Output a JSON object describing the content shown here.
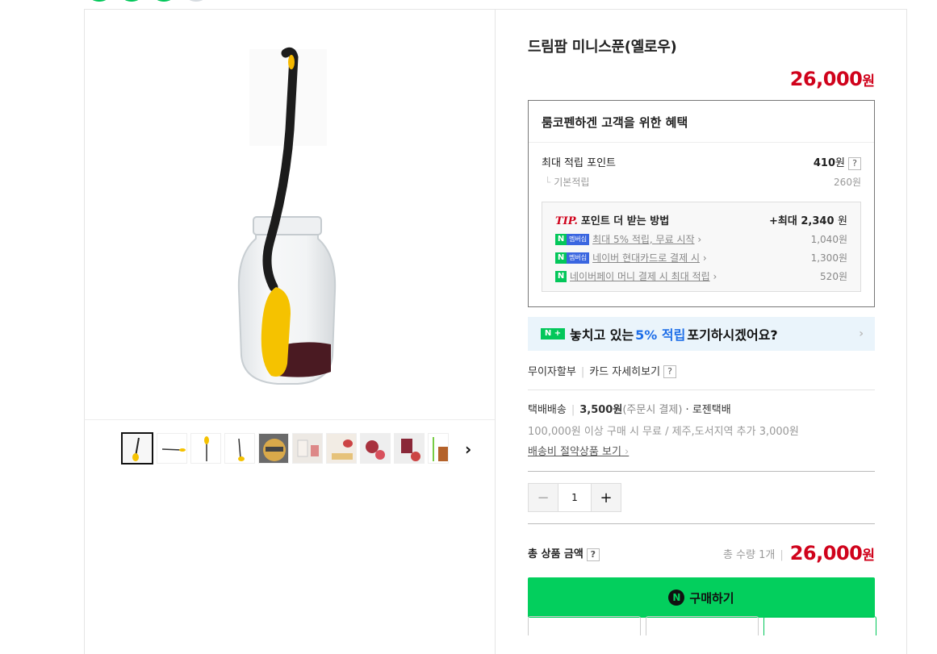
{
  "product": {
    "title": "드림팜 미니스푼(옐로우)",
    "price": "26,000",
    "currency": "원"
  },
  "gallery": {
    "next_icon": "chevron-right-icon",
    "thumbnail_count": 10,
    "selected_index": 0
  },
  "benefit": {
    "heading": "룸코펜하겐 고객을 위한 혜택",
    "max_points_label": "최대 적립 포인트",
    "max_points_value": "410",
    "max_points_unit": "원",
    "help": "?",
    "basic_label": "기본적립",
    "basic_value": "260원",
    "tip": {
      "tip_word": "TIP.",
      "heading": "포인트 더 받는 방법",
      "max_prefix": "+최대",
      "max_value": "2,340",
      "max_unit": "원",
      "items": [
        {
          "badge": "N",
          "badge2": "멤버십",
          "label": "최대 5% 적립, 무료 시작",
          "value": "1,040원"
        },
        {
          "badge": "N",
          "badge2": "멤버십",
          "label": "네이버 현대카드로 결제 시",
          "value": "1,300원"
        },
        {
          "badge": "N",
          "badge2": "",
          "label": "네이버페이 머니 결제 시 최대 적립",
          "value": "520원"
        }
      ]
    }
  },
  "banner": {
    "badge": "N +",
    "text_before": "놓치고 있는",
    "highlight": "5% 적립",
    "text_after": "포기하시겠어요?"
  },
  "card": {
    "installment": "무이자할부",
    "details": "카드 자세히보기",
    "help": "?"
  },
  "shipping": {
    "method": "택배배송",
    "fee": "3,500원",
    "fee_note": "(주문시 결제)",
    "carrier": "로젠택배",
    "condition": "100,000원 이상 구매 시 무료 / 제주,도서지역 추가 3,000원",
    "link": "배송비 절약상품 보기"
  },
  "quantity": {
    "minus": "−",
    "value": "1",
    "plus": "+"
  },
  "total": {
    "label": "총 상품 금액",
    "help": "?",
    "count": "총 수량 1개",
    "price": "26,000",
    "unit": "원"
  },
  "buy": {
    "logo": "N",
    "label": "구매하기"
  },
  "colors": {
    "price_red": "#d0021b",
    "naver_green": "#03c75a",
    "highlight_blue": "#1e6ee8"
  }
}
